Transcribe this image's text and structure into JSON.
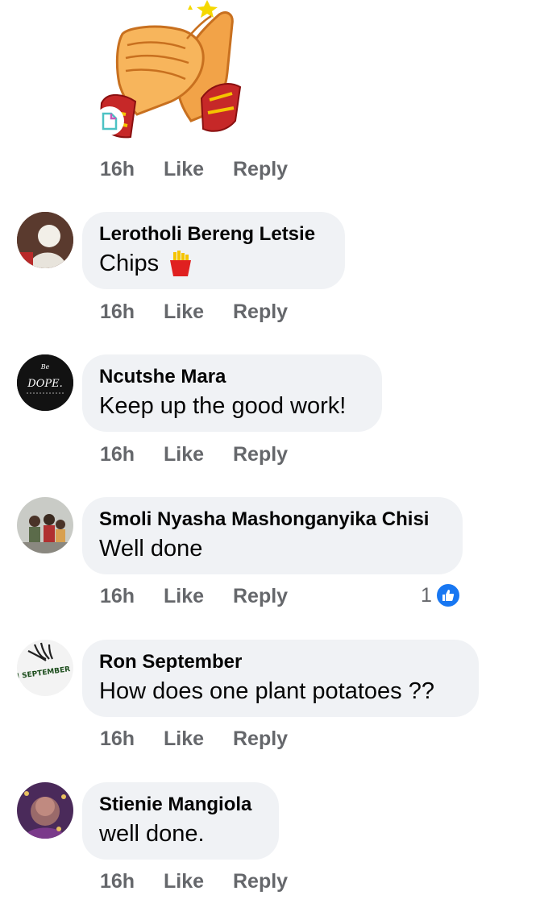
{
  "sticker": {
    "icon": "clapping-hands-sticker"
  },
  "sticker_meta": {
    "time": "16h",
    "like": "Like",
    "reply": "Reply"
  },
  "comments": [
    {
      "name": "Lerotholi Bereng Letsie",
      "text": "Chips",
      "emoji": "french-fries-icon",
      "time": "16h",
      "like": "Like",
      "reply": "Reply"
    },
    {
      "name": "Ncutshe Mara",
      "text": "Keep up the good work!",
      "avatar_text_top": "Be",
      "avatar_text_main": "DOPE.",
      "time": "16h",
      "like": "Like",
      "reply": "Reply"
    },
    {
      "name": "Smoli Nyasha Mashonganyika Chisi",
      "text": "Well done",
      "time": "16h",
      "like": "Like",
      "reply": "Reply",
      "reaction_count": "1"
    },
    {
      "name": "Ron September",
      "text": "How does one plant potatoes ??",
      "avatar_text_main": "RON SEPTEMBER",
      "time": "16h",
      "like": "Like",
      "reply": "Reply"
    },
    {
      "name": "Stienie Mangiola",
      "text": "well done.",
      "time": "16h",
      "like": "Like",
      "reply": "Reply"
    }
  ],
  "colors": {
    "bubble": "#f0f2f5",
    "meta": "#65676b",
    "like_blue": "#1877f2"
  }
}
